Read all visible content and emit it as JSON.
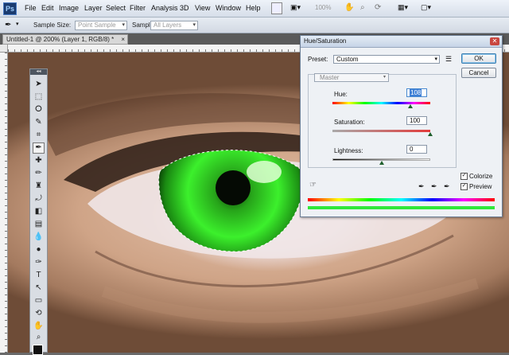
{
  "app": {
    "logo": "Ps"
  },
  "menu": [
    "File",
    "Edit",
    "Image",
    "Layer",
    "Select",
    "Filter",
    "Analysis",
    "3D",
    "View",
    "Window",
    "Help"
  ],
  "menubar_tools": {
    "zoom_value": "100%"
  },
  "options_bar": {
    "sample_size_label": "Sample Size:",
    "sample_size_value": "Point Sample",
    "sample_label": "Sample:",
    "sample_value": "All Layers"
  },
  "document": {
    "tab_title": "Untitled-1 @ 200% (Layer 1, RGB/8) *",
    "close": "×"
  },
  "tools_panel": {
    "header": "◂◂"
  },
  "dialog": {
    "title": "Hue/Saturation",
    "close": "✕",
    "preset_label": "Preset:",
    "preset_value": "Custom",
    "ok_label": "OK",
    "cancel_label": "Cancel",
    "channel_value": "Master",
    "hue_label": "Hue:",
    "hue_value": "108",
    "saturation_label": "Saturation:",
    "saturation_value": "100",
    "lightness_label": "Lightness:",
    "lightness_value": "0",
    "colorize_label": "Colorize",
    "colorize_checked": true,
    "preview_label": "Preview",
    "preview_checked": true,
    "hue_slider": {
      "min": -180,
      "max": 180,
      "value": 108
    },
    "saturation_slider": {
      "min": 0,
      "max": 100,
      "value": 100
    },
    "lightness_slider": {
      "min": -100,
      "max": 100,
      "value": 0
    }
  },
  "colors": {
    "accent": "#3d7fd6",
    "colorized_iris": "#30e83a",
    "foreground": "#111111"
  }
}
